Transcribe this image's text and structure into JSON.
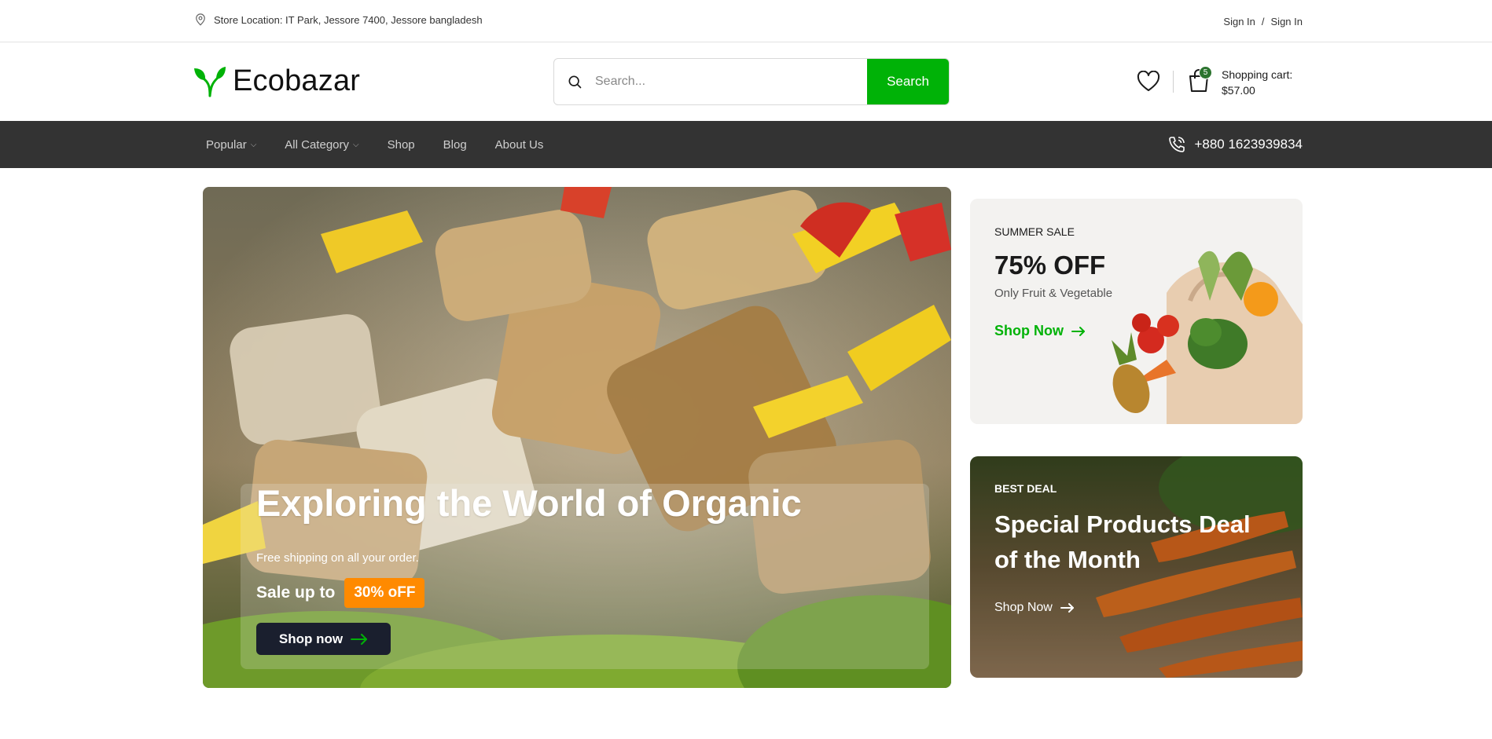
{
  "topbar": {
    "location_text": "Store Location: IT Park, Jessore 7400, Jessore bangladesh",
    "sign_in_1": "Sign In",
    "separator": "/",
    "sign_in_2": "Sign In"
  },
  "header": {
    "logo_text": "Ecobazar",
    "search_placeholder": "Search...",
    "search_button": "Search",
    "cart_count": "5",
    "cart_label": "Shopping cart:",
    "cart_total": "$57.00"
  },
  "nav": {
    "items": [
      {
        "label": "Popular",
        "has_dropdown": true
      },
      {
        "label": "All Category",
        "has_dropdown": true
      },
      {
        "label": "Shop",
        "has_dropdown": false
      },
      {
        "label": "Blog",
        "has_dropdown": false
      },
      {
        "label": "About Us",
        "has_dropdown": false
      }
    ],
    "phone": "+880 1623939834"
  },
  "hero": {
    "title": "Exploring the World of Organic",
    "subtitle": "Free shipping on all your order.",
    "sale_label": "Sale up to",
    "sale_badge": "30% oFF",
    "button": "Shop now"
  },
  "card_summer": {
    "tag": "SUMMER SALE",
    "discount": "75% OFF",
    "subtitle": "Only Fruit & Vegetable",
    "link": "Shop Now"
  },
  "card_deal": {
    "tag": "BEST DEAL",
    "title": "Special Products Deal of the Month",
    "link": "Shop Now"
  },
  "colors": {
    "brand_green": "#00b207",
    "nav_bg": "#333333",
    "badge_orange": "#ff8a00",
    "dark_button": "#1a1f2e"
  }
}
